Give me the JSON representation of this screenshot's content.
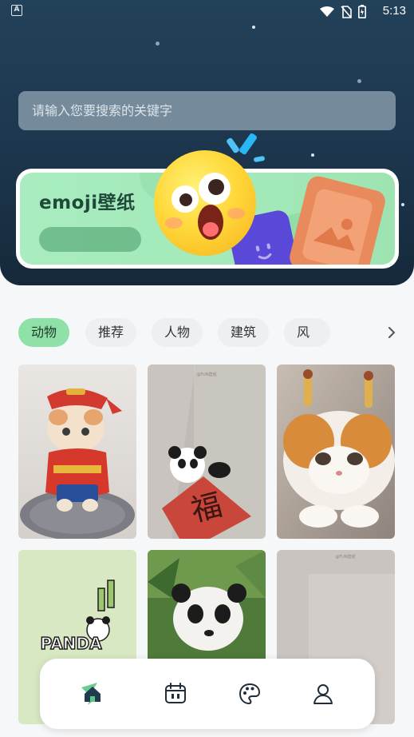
{
  "status_bar": {
    "time": "5:13",
    "left_badge": "A",
    "icons": [
      "wifi-icon",
      "no-sim-icon",
      "battery-icon"
    ]
  },
  "search": {
    "placeholder": "请输入您要搜索的关键字"
  },
  "banner": {
    "title": "emoji壁纸"
  },
  "tabs": {
    "items": [
      "动物",
      "推荐",
      "人物",
      "建筑",
      "风景"
    ],
    "active_index": 0,
    "more_icon": "chevron-right-icon"
  },
  "grid": {
    "items": [
      {
        "subject": "cat-in-costume"
      },
      {
        "subject": "panda-fu"
      },
      {
        "subject": "cat-with-antlers"
      },
      {
        "subject": "panda-sticker"
      },
      {
        "subject": "panda-photo"
      },
      {
        "subject": "plain-wall"
      }
    ],
    "watermark_text": "@FUN壁纸"
  },
  "bottom_nav": {
    "items": [
      {
        "icon": "home-icon",
        "active": true
      },
      {
        "icon": "calendar-icon",
        "active": false
      },
      {
        "icon": "palette-icon",
        "active": false
      },
      {
        "icon": "profile-icon",
        "active": false
      }
    ]
  },
  "colors": {
    "header_dark": "#1d3850",
    "accent_green": "#8fe1a7",
    "banner_green": "#a8ecbf"
  }
}
